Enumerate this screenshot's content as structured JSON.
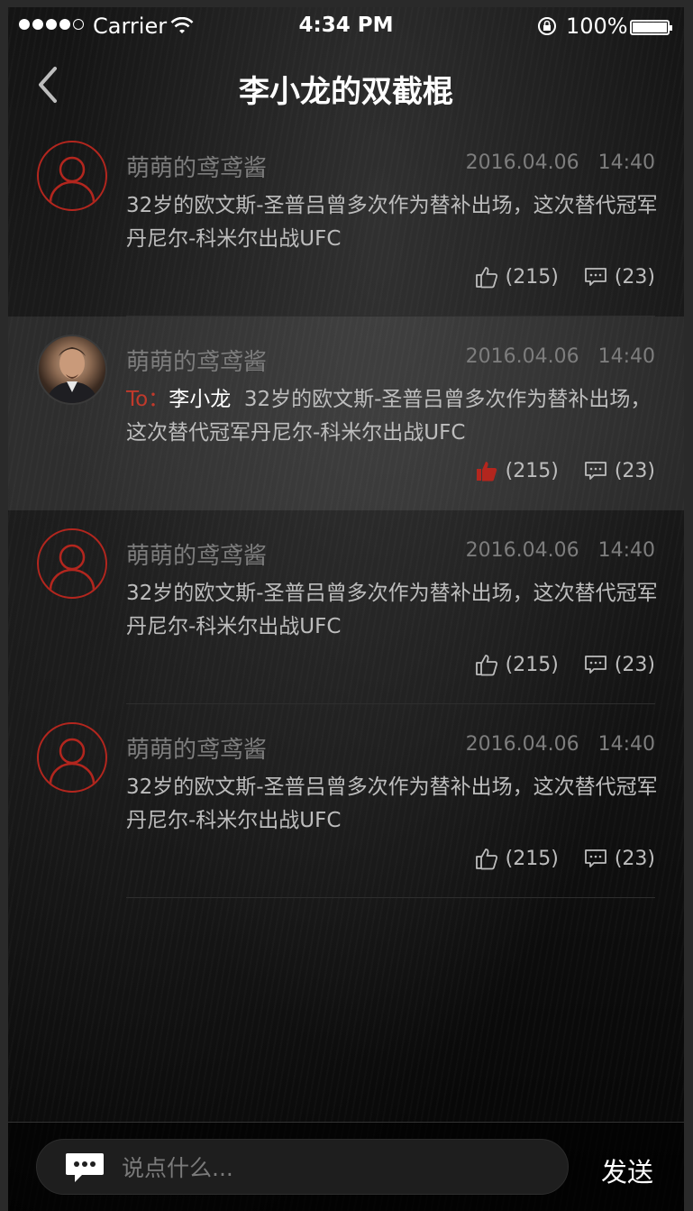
{
  "status_bar": {
    "carrier": "Carrier",
    "time": "4:34 PM",
    "battery": "100%",
    "signal_filled": 4,
    "signal_total": 5
  },
  "nav": {
    "back_icon": "chevron-left-icon",
    "title": "李小龙的双截棍"
  },
  "comments": [
    {
      "username": "萌萌的鸢鸢酱",
      "date": "2016.04.06",
      "time": "14:40",
      "avatar": "default-red",
      "text": "32岁的欧文斯-圣普吕曾多次作为替补出场，这次替代冠军丹尼尔-科米尔出战UFC",
      "likes": "(215)",
      "replies": "(23)",
      "liked": false
    },
    {
      "username": "萌萌的鸢鸢酱",
      "date": "2016.04.06",
      "time": "14:40",
      "avatar": "photo",
      "reply_prefix": "To：",
      "reply_to": "李小龙",
      "text": "32岁的欧文斯-圣普吕曾多次作为替补出场，这次替代冠军丹尼尔-科米尔出战UFC",
      "likes": "(215)",
      "replies": "(23)",
      "liked": true
    },
    {
      "username": "萌萌的鸢鸢酱",
      "date": "2016.04.06",
      "time": "14:40",
      "avatar": "default-red",
      "text": "32岁的欧文斯-圣普吕曾多次作为替补出场，这次替代冠军丹尼尔-科米尔出战UFC",
      "likes": "(215)",
      "replies": "(23)",
      "liked": false
    },
    {
      "username": "萌萌的鸢鸢酱",
      "date": "2016.04.06",
      "time": "14:40",
      "avatar": "default-red",
      "text": "32岁的欧文斯-圣普吕曾多次作为替补出场，这次替代冠军丹尼尔-科米尔出战UFC",
      "likes": "(215)",
      "replies": "(23)",
      "liked": false
    }
  ],
  "composer": {
    "placeholder": "说点什么...",
    "send_label": "发送"
  },
  "colors": {
    "accent_red": "#b3261e",
    "text_primary": "#bdbdbd",
    "text_muted": "#7d7d7d"
  }
}
